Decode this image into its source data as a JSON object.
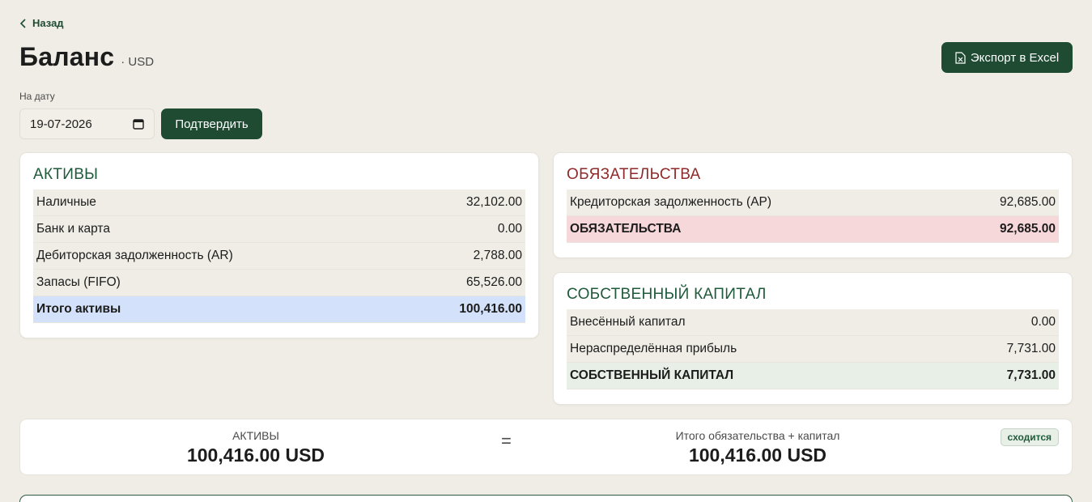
{
  "nav": {
    "back_label": "Назад"
  },
  "header": {
    "title": "Баланс",
    "currency": "· USD",
    "export_label": "Экспорт в Excel"
  },
  "filter": {
    "date_label": "На дату",
    "date_value": "19-07-2026",
    "confirm_label": "Подтвердить"
  },
  "assets": {
    "title": "АКТИВЫ",
    "rows": [
      {
        "label": "Наличные",
        "value": "32,102.00"
      },
      {
        "label": "Банк и карта",
        "value": "0.00"
      },
      {
        "label": "Дебиторская задолженность (AR)",
        "value": "2,788.00"
      },
      {
        "label": "Запасы (FIFO)",
        "value": "65,526.00"
      }
    ],
    "total_label": "Итого активы",
    "total_value": "100,416.00"
  },
  "liabilities": {
    "title": "ОБЯЗАТЕЛЬСТВА",
    "rows": [
      {
        "label": "Кредиторская задолженность (AP)",
        "value": "92,685.00"
      }
    ],
    "total_label": "ОБЯЗАТЕЛЬСТВА",
    "total_value": "92,685.00"
  },
  "equity": {
    "title": "СОБСТВЕННЫЙ КАПИТАЛ",
    "rows": [
      {
        "label": "Внесённый капитал",
        "value": "0.00"
      },
      {
        "label": "Нераспределённая прибыль",
        "value": "7,731.00"
      }
    ],
    "total_label": "СОБСТВЕННЫЙ КАПИТАЛ",
    "total_value": "7,731.00"
  },
  "summary": {
    "left_label": "АКТИВЫ",
    "left_value": "100,416.00 USD",
    "equals": "=",
    "right_label": "Итого обязательства + капитал",
    "right_value": "100,416.00 USD",
    "badge": "сходится"
  },
  "icons": {
    "back": "chevron-left-icon",
    "export": "excel-file-icon",
    "calendar": "calendar-icon"
  },
  "colors": {
    "primary": "#1f4b33",
    "assets_total": "#d3e2fa",
    "liabilities_total": "#f7d8da",
    "equity_total": "#e7efe7"
  }
}
